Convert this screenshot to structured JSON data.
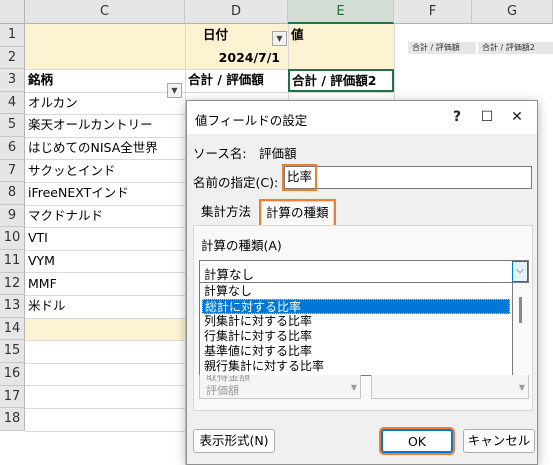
{
  "sheet": {
    "columns": [
      "C",
      "D",
      "E",
      "F",
      "G"
    ],
    "rows": [
      "1",
      "2",
      "3",
      "4",
      "5",
      "6",
      "7",
      "8",
      "9",
      "10",
      "11",
      "12",
      "13",
      "14",
      "15",
      "16",
      "17",
      "18"
    ],
    "d1": "日付",
    "e1": "値",
    "d2": "2024/7/1",
    "c3": "銘柄",
    "d3": "合計 / 評価額",
    "e3": "合計 / 評価額2",
    "names": [
      "オルカン",
      "楽天オールカントリー",
      "はじめてのNISA全世界",
      "サクッとインド",
      "iFreeNEXTインド",
      "マクドナルド",
      "VTI",
      "VYM",
      "MMF",
      "米ドル"
    ],
    "mini1": "合計 / 評価額",
    "mini2": "合計 / 評価額2",
    "dropdown_icon": "chevron-down-icon",
    "filter_icon": "filter-icon"
  },
  "dialog": {
    "title": "値フィールドの設定",
    "source_label": "ソース名:",
    "source_value": "評価額",
    "name_label": "名前の指定(C):",
    "name_value": "比率",
    "tab1": "集計方法",
    "tab2": "計算の種類",
    "calc_label": "計算の種類(A)",
    "calc_selected": "計算なし",
    "options": [
      "計算なし",
      "総計に対する比率",
      "列集計に対する比率",
      "行集計に対する比率",
      "基準値に対する比率",
      "親行集計に対する比率"
    ],
    "selected_option": "総計に対する比率",
    "hidden1": "取得金額",
    "hidden2": "評価額",
    "number_format": "表示形式(N)",
    "ok": "OK",
    "cancel": "キャンセル",
    "highlight_color": "#ed7d31",
    "selection_color": "#0078d7"
  }
}
